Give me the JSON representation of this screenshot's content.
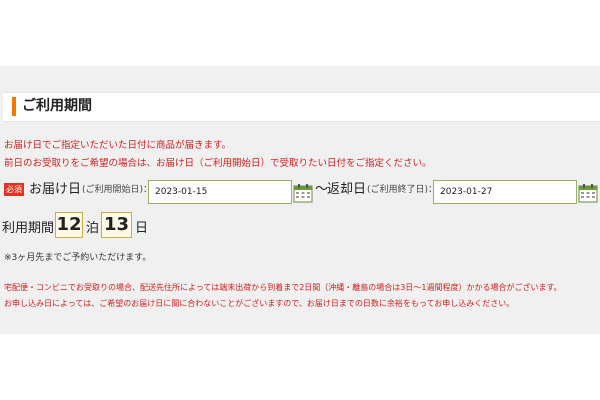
{
  "section": {
    "title": "ご利用期間",
    "accent_color": "#f07800"
  },
  "notices": {
    "line1": "お届け日でご指定いただいた日付に商品が届きます。",
    "line2": "前日のお受取りをご希望の場合は、お届け日（ご利用開始日）で受取りたい日付をご指定ください。"
  },
  "form": {
    "required_badge": "必須",
    "delivery_label": "お届け日",
    "delivery_sublabel": "(ご利用開始日)：",
    "delivery_value": "2023-01-15",
    "separator": "～",
    "return_label": "返却日",
    "return_sublabel": "(ご利用終了日)：",
    "return_value": "2023-01-27",
    "calendar_icon": "calendar-icon"
  },
  "period": {
    "label": "利用期間",
    "nights": "12",
    "nights_unit": "泊",
    "days": "13",
    "days_unit": "日"
  },
  "note": "※3ヶ月先までご予約いただけます。",
  "warnings": {
    "line1": "宅配便・コンビニでお受取りの場合、配送先住所によっては端末出荷から到着まで2日間（沖縄・離島の場合は3日〜1週間程度）かかる場合がございます。",
    "line2": "お申し込み日によっては、ご希望のお届け日に間に合わないことがございますので、お届け日までの日数に余裕をもってお申し込みください。"
  },
  "colors": {
    "notice_red": "#d02020",
    "badge_red": "#e63020",
    "input_border": "#9ab06a",
    "number_box_bg": "#fdf9e6"
  }
}
